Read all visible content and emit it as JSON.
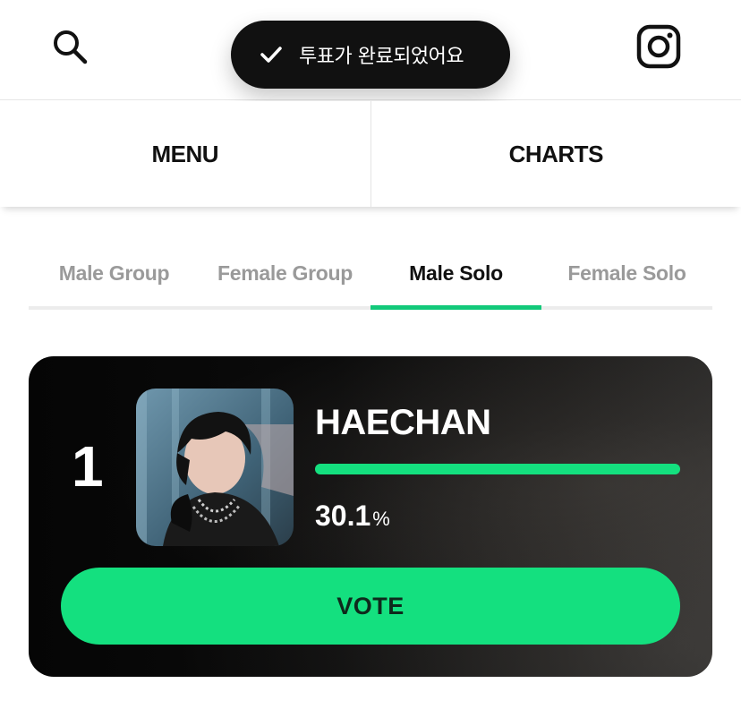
{
  "header": {
    "search_icon": "search-icon",
    "instagram_icon": "instagram-icon"
  },
  "toast": {
    "icon": "check-icon",
    "message": "투표가 완료되었어요"
  },
  "nav": {
    "menu_label": "MENU",
    "charts_label": "CHARTS"
  },
  "tabs": [
    {
      "label": "Male Group",
      "active": false
    },
    {
      "label": "Female Group",
      "active": false
    },
    {
      "label": "Male Solo",
      "active": true
    },
    {
      "label": "Female Solo",
      "active": false
    }
  ],
  "ranking": {
    "rank": "1",
    "artist": "HAECHAN",
    "percent_value": "30.1",
    "percent_unit": "%",
    "vote_label": "VOTE",
    "bar_fill_fraction": 1.0
  },
  "colors": {
    "accent": "#14e07f",
    "tab_underline": "#12c97a",
    "toast_bg": "#111111",
    "card_bg": "#0b0b0b"
  }
}
